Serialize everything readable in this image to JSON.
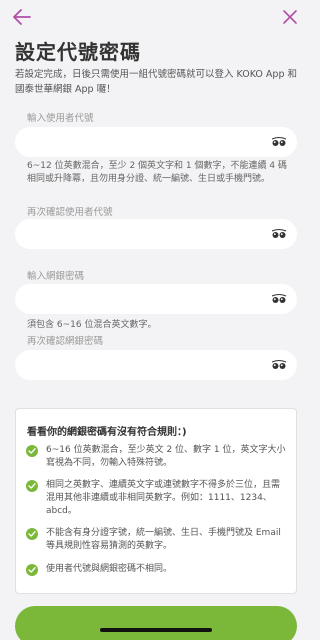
{
  "header": {
    "title": "設定代號密碼",
    "description": "若設定完成，日後只需使用一組代號密碼就可以登入 KOKO App 和國泰世華網銀 App 囉！"
  },
  "colors": {
    "accent_purple": "#b04fa8",
    "accent_green": "#7bb83a"
  },
  "icons": {
    "back": "back-arrow-icon",
    "close": "close-icon",
    "eye": "eye-closed-icon",
    "check": "check-circle-icon"
  },
  "form": {
    "user_id": {
      "label": "輸入使用者代號",
      "value": "",
      "hint": "6~12 位英數混合，至少 2 個英文字和 1 個數字，不能連續 4 碼相同或升降冪，且勿用身分證、統一編號、生日或手機門號。"
    },
    "user_id_confirm": {
      "label": "再次確認使用者代號",
      "value": ""
    },
    "password": {
      "label": "輸入網銀密碼",
      "value": "",
      "hint": "須包含 6~16 位混合英文數字。"
    },
    "password_confirm": {
      "label": "再次確認網銀密碼",
      "value": ""
    }
  },
  "rules": {
    "title": "看看你的網銀密碼有沒有符合規則：)",
    "items": [
      {
        "text": "6~16 位英數混合，至少英文 2 位、數字 1 位，英文字大小寫視為不同，勿輸入特殊符號。",
        "met": true
      },
      {
        "text": "相同之英數字、連續英文字或連號數字不得多於三位，且需混用其他非連續或非相同英數字。例如：1111、1234、abcd。",
        "met": true
      },
      {
        "text": "不能含有身分證字號，統一編號、生日、手機門號及 Email 等具規則性容易猜測的英數字。",
        "met": true
      },
      {
        "text": "使用者代號與網銀密碼不相同。",
        "met": true
      }
    ]
  }
}
